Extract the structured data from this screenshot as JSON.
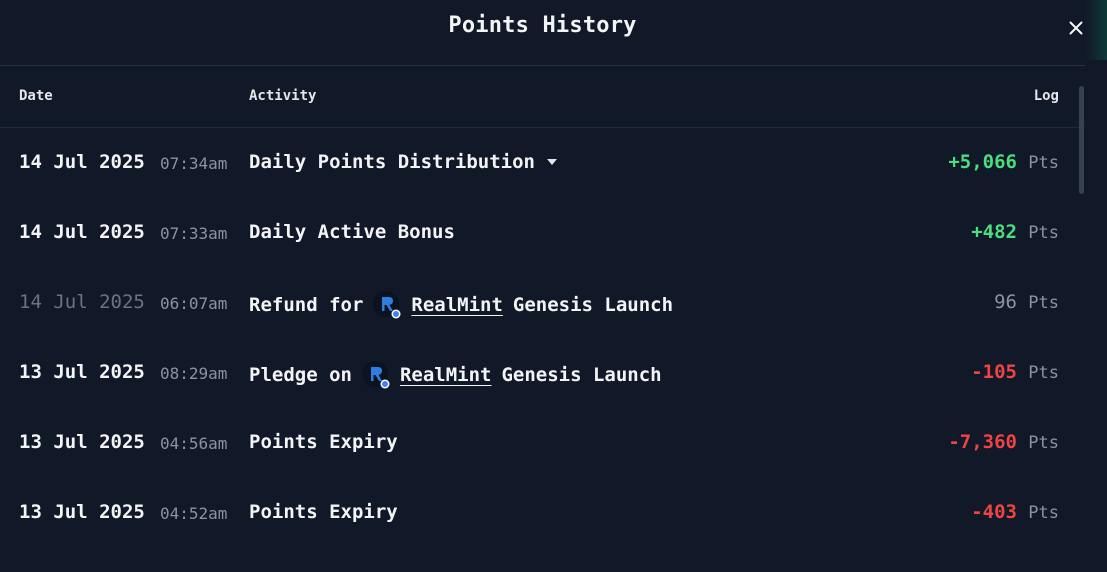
{
  "modal": {
    "title": "Points History",
    "close_icon": "close-icon"
  },
  "columns": {
    "date": "Date",
    "activity": "Activity",
    "log": "Log"
  },
  "colors": {
    "background": "#111827",
    "positive": "#4ade80",
    "negative": "#ef4444",
    "muted": "#8b93a1"
  },
  "rows": [
    {
      "date": "14 Jul 2025",
      "time": "07:34am",
      "activity": "Daily Points Distribution",
      "amount": "+5,066",
      "unit": "Pts",
      "status": "positive",
      "expandable": true
    },
    {
      "date": "14 Jul 2025",
      "time": "07:33am",
      "activity": "Daily Active Bonus",
      "amount": "+482",
      "unit": "Pts",
      "status": "positive"
    },
    {
      "date": "14 Jul 2025",
      "time": "06:07am",
      "activity_prefix": "Refund for",
      "token": "RealMint",
      "activity_suffix": "Genesis Launch",
      "amount": "96",
      "unit": "Pts",
      "status": "neutral",
      "dimmed": true
    },
    {
      "date": "13 Jul 2025",
      "time": "08:29am",
      "activity_prefix": "Pledge on",
      "token": "RealMint",
      "activity_suffix": "Genesis Launch",
      "amount": "-105",
      "unit": "Pts",
      "status": "negative"
    },
    {
      "date": "13 Jul 2025",
      "time": "04:56am",
      "activity": "Points Expiry",
      "amount": "-7,360",
      "unit": "Pts",
      "status": "negative"
    },
    {
      "date": "13 Jul 2025",
      "time": "04:52am",
      "activity": "Points Expiry",
      "amount": "-403",
      "unit": "Pts",
      "status": "negative"
    }
  ]
}
